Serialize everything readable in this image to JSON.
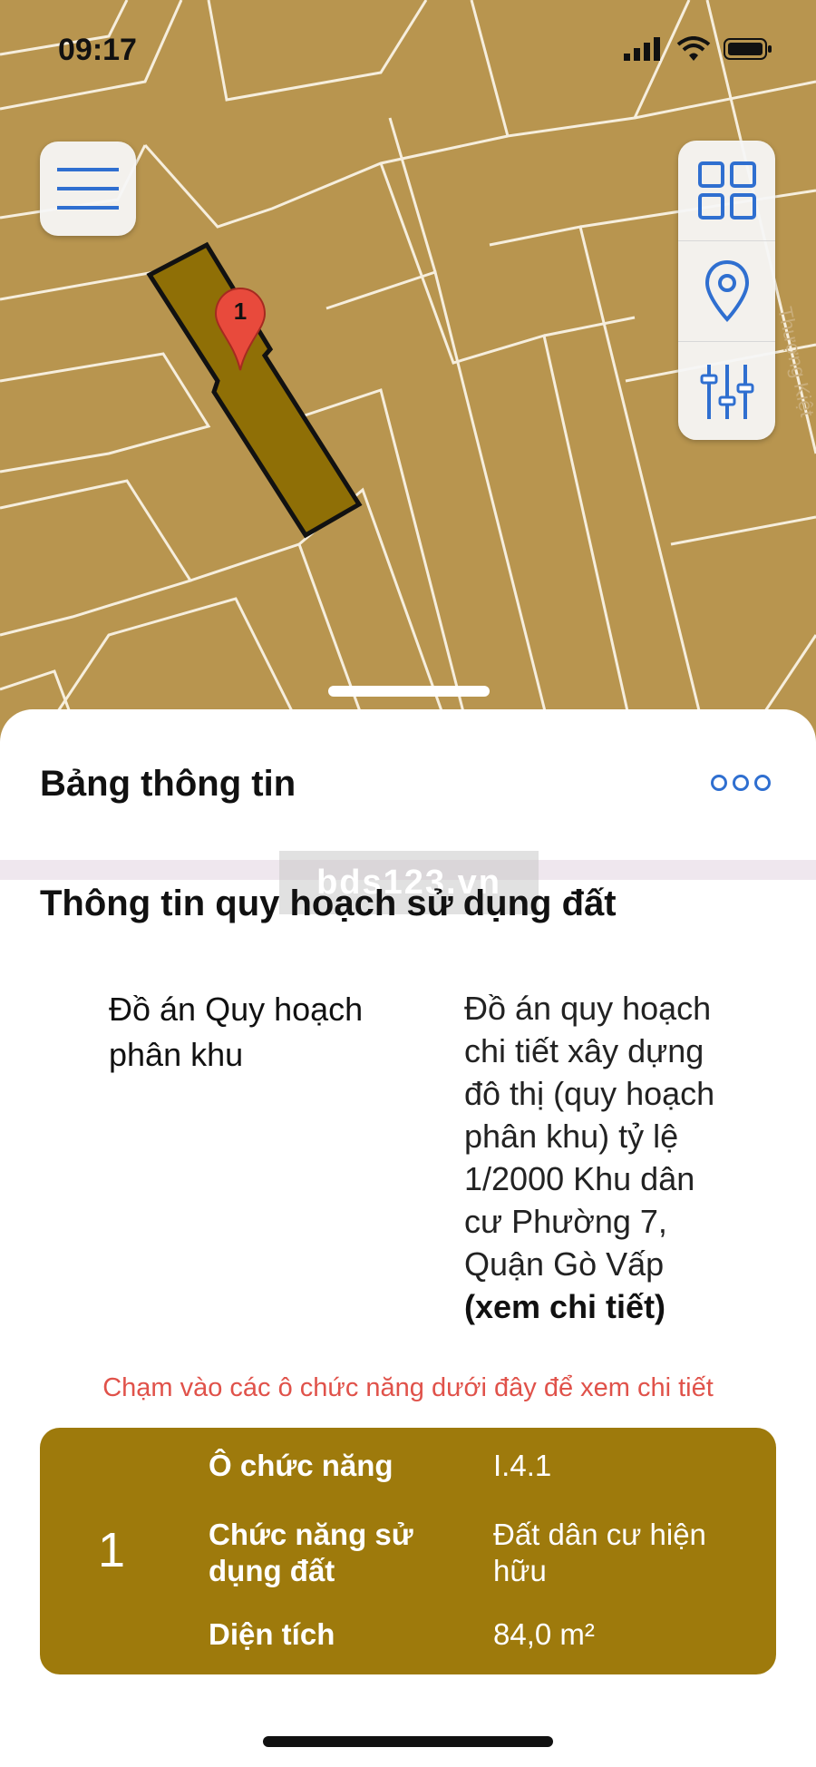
{
  "status": {
    "time": "09:17"
  },
  "map": {
    "marker_label": "1",
    "street_label": "Thượng Kiệt",
    "parcel_fill": "#8f6f06",
    "map_fill": "#b8954f"
  },
  "sheet": {
    "title": "Bảng thông tin",
    "watermark": "bds123.vn",
    "section_title": "Thông tin quy hoạch sử dụng đất",
    "info": {
      "label": "Đồ án Quy hoạch phân khu",
      "value_lines": [
        "Đồ án quy hoạch",
        "chi tiết xây dựng",
        "đô thị (quy hoạch",
        "phân khu) tỷ lệ",
        "1/2000  Khu dân",
        "cư Phường 7,",
        "Quận Gò Vấp"
      ],
      "link": "(xem chi tiết)"
    },
    "hint": "Chạm vào các ô chức năng dưới đây để xem chi tiết",
    "card": {
      "number": "1",
      "rows": [
        {
          "label": "Ô chức năng",
          "value": "I.4.1"
        },
        {
          "label": "Chức năng sử dụng đất",
          "value": "Đất dân cư hiện hữu"
        },
        {
          "label": "Diện tích",
          "value": "84,0 m²"
        }
      ]
    }
  }
}
